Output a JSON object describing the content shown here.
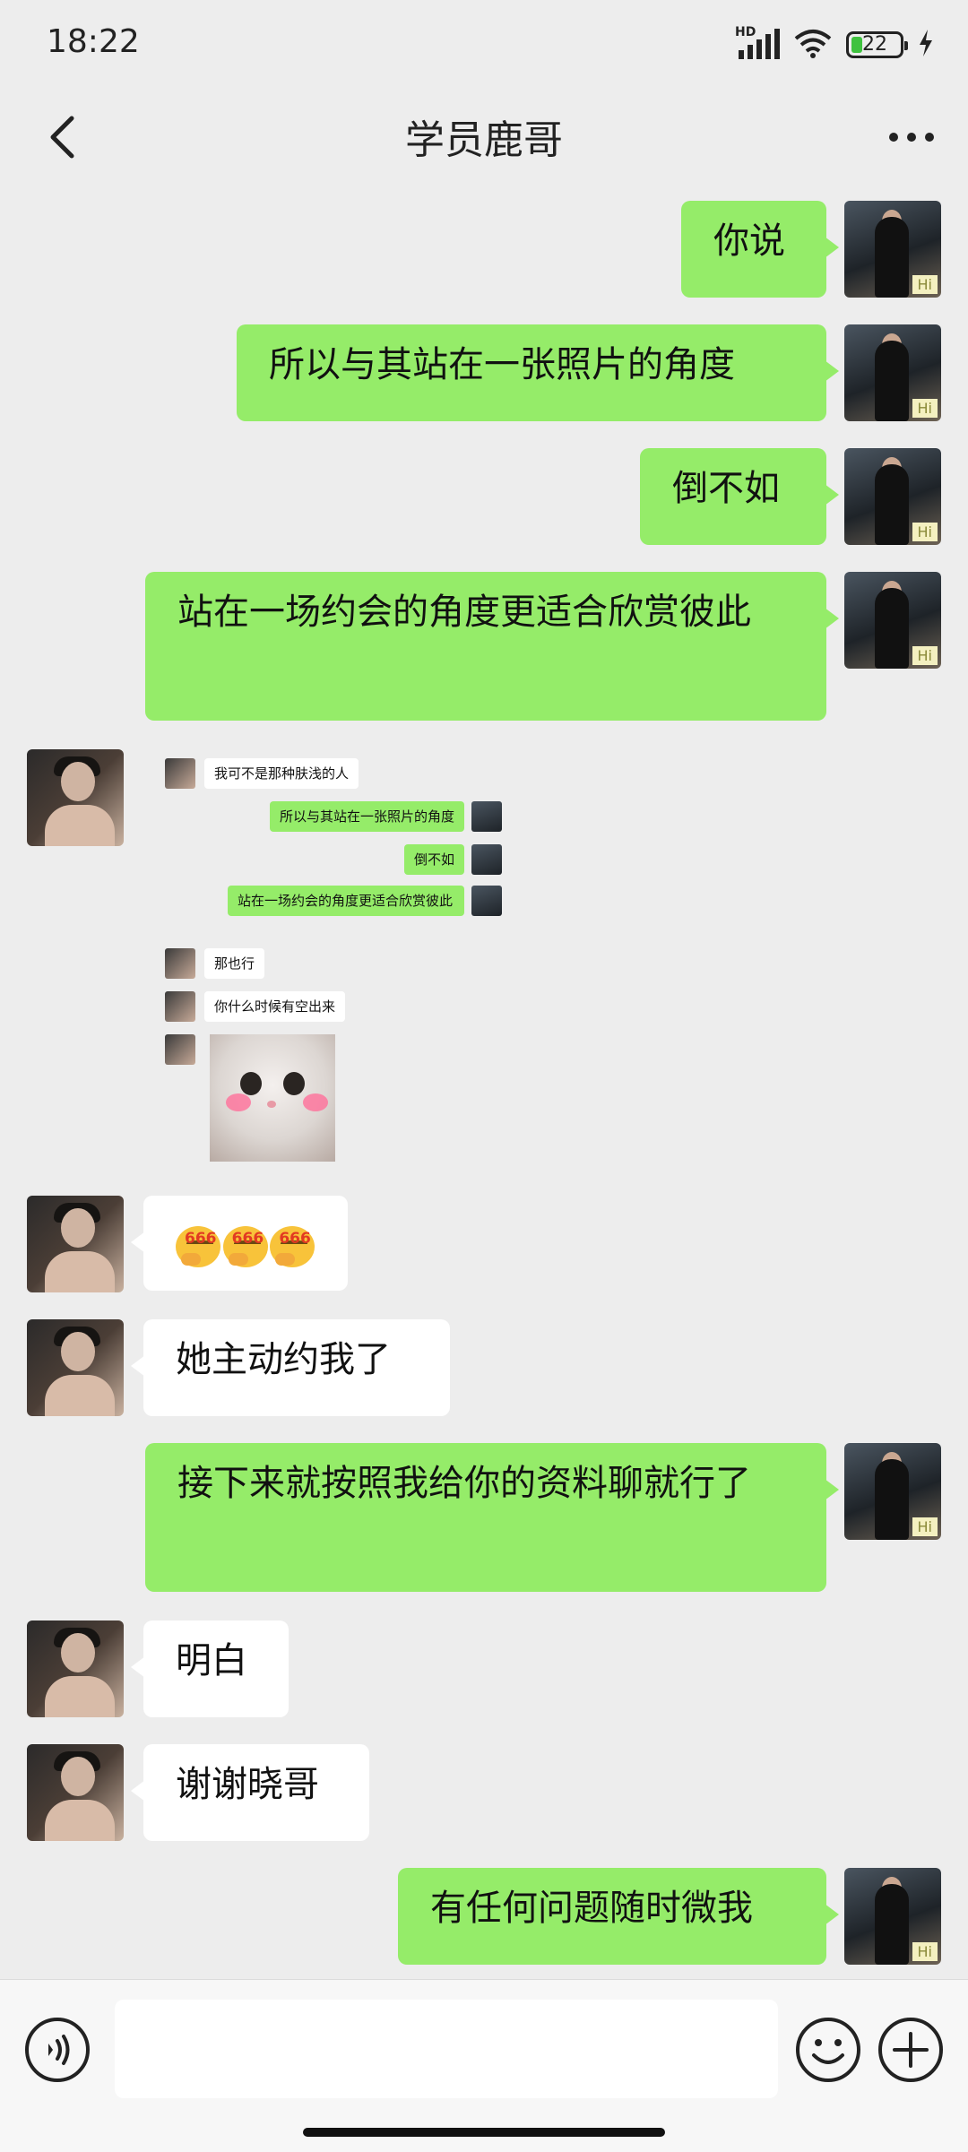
{
  "status_bar": {
    "time": "18:22",
    "network_label": "HD",
    "battery_level": "22",
    "icons": [
      "hd-signal-icon",
      "wifi-icon",
      "battery-icon",
      "charging-icon"
    ]
  },
  "header": {
    "title": "学员鹿哥",
    "back_icon": "chevron-left-icon",
    "more_icon": "more-dots-icon"
  },
  "avatar_badge": "Hi",
  "messages": [
    {
      "from": "me",
      "text": "你说"
    },
    {
      "from": "me",
      "text": "所以与其站在一张照片的角度"
    },
    {
      "from": "me",
      "text": "倒不如"
    },
    {
      "from": "me",
      "text": "站在一场约会的角度更适合欣赏彼此"
    },
    {
      "from": "them",
      "type": "image"
    },
    {
      "from": "them",
      "type": "emoji",
      "emoji_text": "666"
    },
    {
      "from": "them",
      "text": "她主动约我了"
    },
    {
      "from": "me",
      "text": "接下来就按照我给你的资料聊就行了"
    },
    {
      "from": "them",
      "text": "明白"
    },
    {
      "from": "them",
      "text": "谢谢晓哥"
    },
    {
      "from": "me",
      "text": "有任何问题随时微我"
    }
  ],
  "screenshot_messages": [
    {
      "from": "them",
      "text": "我可不是那种肤浅的人"
    },
    {
      "from": "me",
      "text": "所以与其站在一张照片的角度"
    },
    {
      "from": "me",
      "text": "倒不如"
    },
    {
      "from": "me",
      "text": "站在一场约会的角度更适合欣赏彼此"
    },
    {
      "from": "them",
      "text": "那也行"
    },
    {
      "from": "them",
      "text": "你什么时候有空出来"
    },
    {
      "from": "them",
      "type": "sticker",
      "icon": "cat-sticker"
    }
  ],
  "input_bar": {
    "placeholder": "",
    "icons": [
      "voice-icon",
      "emoji-icon",
      "plus-icon"
    ]
  }
}
